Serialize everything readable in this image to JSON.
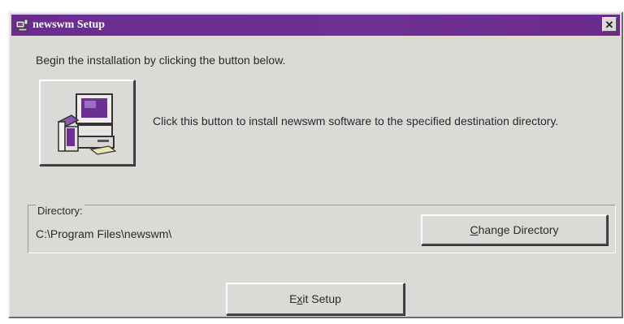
{
  "window": {
    "title": "newswm Setup",
    "close_glyph": "✕",
    "title_icon": "setup-icon",
    "accent_color": "#6b2c8f"
  },
  "intro_text": "Begin the installation by clicking the button below.",
  "install": {
    "icon": "computer-install-icon",
    "description": "Click this button to install newswm software to the specified destination directory."
  },
  "directory": {
    "label": "Directory:",
    "path": "C:\\Program Files\\newswm\\",
    "change_button": {
      "prefix": "",
      "mnemonic": "C",
      "suffix": "hange Directory"
    }
  },
  "exit_button": {
    "prefix": "E",
    "mnemonic": "x",
    "suffix": "it Setup"
  }
}
